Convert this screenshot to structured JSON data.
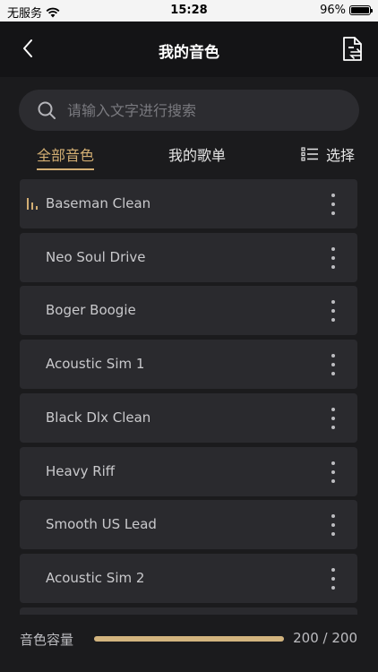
{
  "status_bar": {
    "carrier": "无服务",
    "time": "15:28",
    "battery": "96%"
  },
  "nav": {
    "title": "我的音色"
  },
  "search": {
    "placeholder": "请输入文字进行搜索"
  },
  "tabs": {
    "all": "全部音色",
    "songs": "我的歌单",
    "select": "选择"
  },
  "presets": [
    {
      "name": "Baseman Clean",
      "playing": true
    },
    {
      "name": "Neo Soul Drive",
      "playing": false
    },
    {
      "name": "Boger Boogie",
      "playing": false
    },
    {
      "name": "Acoustic Sim 1",
      "playing": false
    },
    {
      "name": "Black Dlx Clean",
      "playing": false
    },
    {
      "name": "Heavy Riff",
      "playing": false
    },
    {
      "name": "Smooth US Lead",
      "playing": false
    },
    {
      "name": "Acoustic Sim 2",
      "playing": false
    }
  ],
  "capacity": {
    "label": "音色容量",
    "used": 200,
    "total": 200,
    "count_text": "200 / 200"
  },
  "colors": {
    "accent": "#d2ae73",
    "background": "#1b1b1d",
    "row": "#2a2a2e"
  }
}
